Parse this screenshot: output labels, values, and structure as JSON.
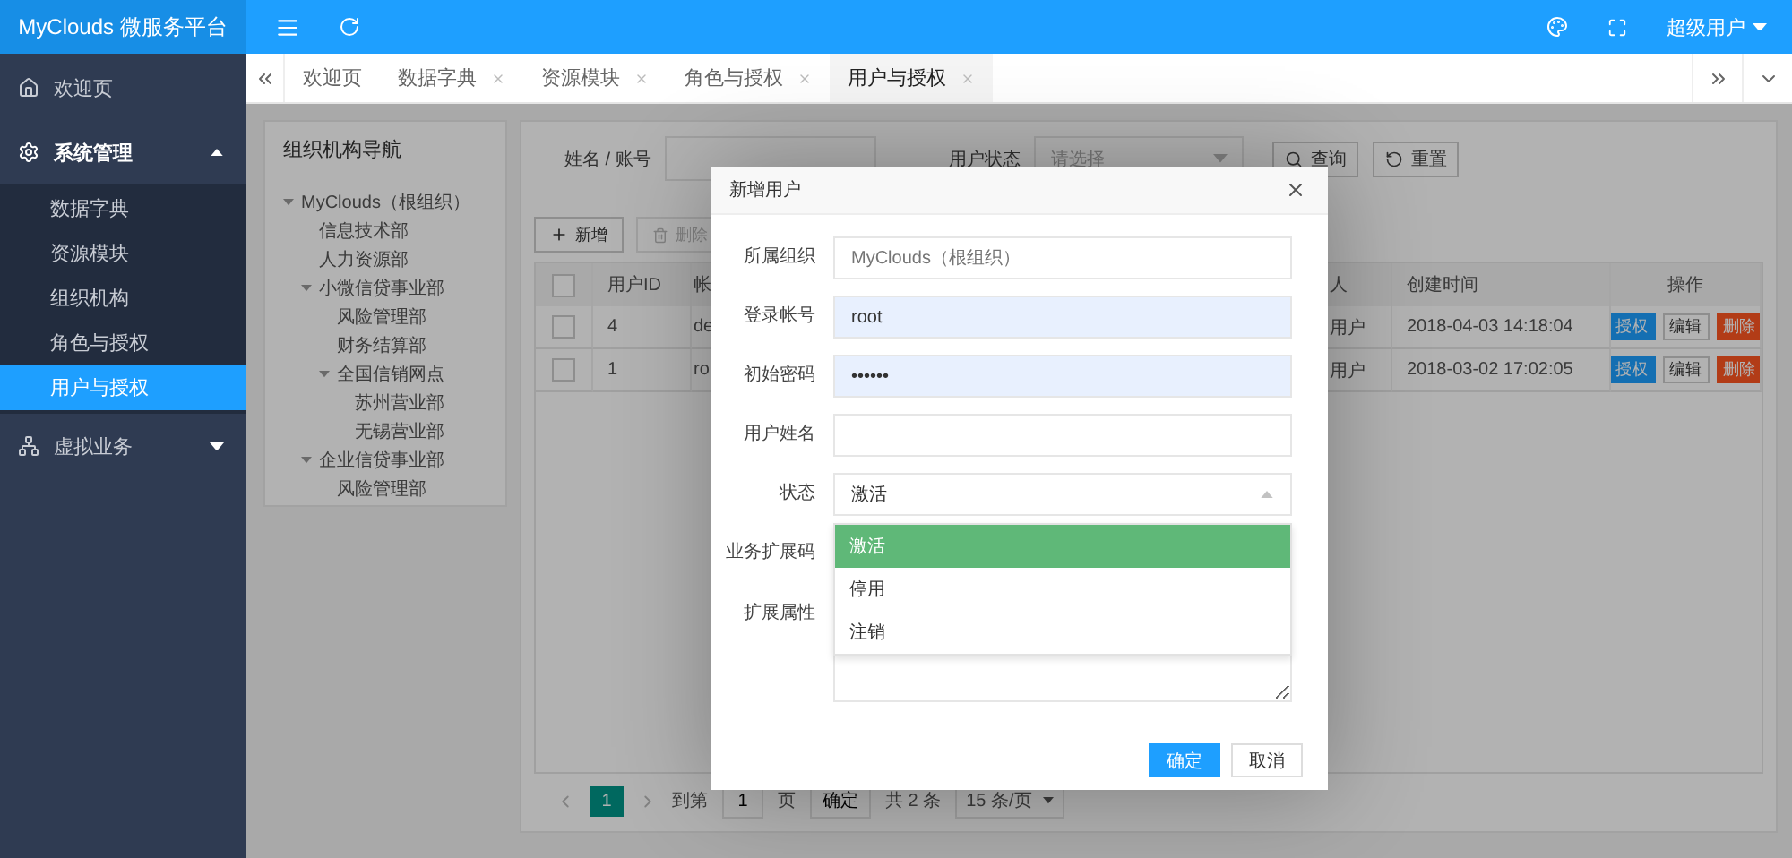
{
  "logo": "MyClouds 微服务平台",
  "header": {
    "user": "超级用户"
  },
  "sidebar": [
    {
      "label": "欢迎页",
      "selected": false
    },
    {
      "label": "系统管理",
      "selected": false,
      "expanded": true,
      "children": [
        {
          "label": "数据字典",
          "selected": false
        },
        {
          "label": "资源模块",
          "selected": false
        },
        {
          "label": "组织机构",
          "selected": false
        },
        {
          "label": "角色与授权",
          "selected": false
        },
        {
          "label": "用户与授权",
          "selected": true
        }
      ]
    },
    {
      "label": "虚拟业务",
      "selected": false,
      "expanded": false
    }
  ],
  "tabs": [
    {
      "label": "欢迎页",
      "closable": false,
      "selected": false
    },
    {
      "label": "数据字典",
      "closable": true,
      "selected": false
    },
    {
      "label": "资源模块",
      "closable": true,
      "selected": false
    },
    {
      "label": "角色与授权",
      "closable": true,
      "selected": false
    },
    {
      "label": "用户与授权",
      "closable": true,
      "selected": true
    }
  ],
  "org_tree": {
    "title": "组织机构导航",
    "nodes": [
      {
        "label": "MyClouds（根组织）",
        "expanded": true,
        "children": [
          {
            "label": "信息技术部"
          },
          {
            "label": "人力资源部"
          },
          {
            "label": "小微信贷事业部",
            "expanded": true,
            "children": [
              {
                "label": "风险管理部"
              },
              {
                "label": "财务结算部"
              },
              {
                "label": "全国信销网点",
                "expanded": true,
                "children": [
                  {
                    "label": "苏州营业部"
                  },
                  {
                    "label": "无锡营业部"
                  }
                ]
              }
            ]
          },
          {
            "label": "企业信贷事业部",
            "expanded": true,
            "children": [
              {
                "label": "风险管理部"
              }
            ]
          }
        ]
      }
    ]
  },
  "search": {
    "fields": [
      {
        "label": "姓名 / 账号",
        "kind": "input"
      },
      {
        "label": "用户状态",
        "kind": "select",
        "placeholder": "请选择"
      }
    ],
    "buttons": [
      "查询",
      "重置"
    ]
  },
  "toolbar": [
    {
      "label": "新增",
      "disabled": false
    },
    {
      "label": "删除",
      "disabled": true
    }
  ],
  "table": {
    "header_checked": false,
    "columns": [
      "用户ID",
      "帐",
      "人",
      "创建时间",
      "操作"
    ],
    "rows": [
      {
        "checked": false,
        "cells": [
          "4",
          "de",
          "用户",
          "2018-04-03 14:18:04"
        ],
        "actions": [
          {
            "label": "授权",
            "kind": "primary"
          },
          {
            "label": "编辑",
            "kind": "default"
          },
          {
            "label": "删除",
            "kind": "danger"
          }
        ]
      },
      {
        "checked": false,
        "cells": [
          "1",
          "ro",
          "用户",
          "2018-03-02 17:02:05"
        ],
        "actions": [
          {
            "label": "授权",
            "kind": "primary"
          },
          {
            "label": "编辑",
            "kind": "default"
          },
          {
            "label": "删除",
            "kind": "danger"
          }
        ]
      }
    ]
  },
  "pager": {
    "pages": [
      {
        "label": "1",
        "selected": true
      }
    ],
    "goto_label": "到第",
    "goto_value": "1",
    "page_label": "页",
    "confirm": "确定",
    "total": "共 2 条",
    "page_size": "15 条/页"
  },
  "dialog": {
    "title": "新增用户",
    "fields": [
      {
        "label": "所属组织",
        "kind": "readonly",
        "placeholder": "MyClouds（根组织）"
      },
      {
        "label": "登录帐号",
        "kind": "text",
        "value": "root",
        "autofilled": true
      },
      {
        "label": "初始密码",
        "kind": "text",
        "value": "••••••",
        "autofilled": true
      },
      {
        "label": "用户姓名",
        "kind": "text",
        "autofilled": false
      },
      {
        "label": "状态",
        "kind": "select",
        "value": "激活",
        "open": true,
        "options": [
          {
            "label": "激活",
            "selected": true
          },
          {
            "label": "停用",
            "selected": false
          },
          {
            "label": "注销",
            "selected": false
          }
        ]
      },
      {
        "label": "业务扩展码",
        "kind": "text"
      },
      {
        "label": "扩展属性",
        "kind": "textarea"
      }
    ],
    "buttons": [
      {
        "label": "确定",
        "kind": "primary"
      },
      {
        "label": "取消",
        "kind": "default"
      }
    ]
  }
}
